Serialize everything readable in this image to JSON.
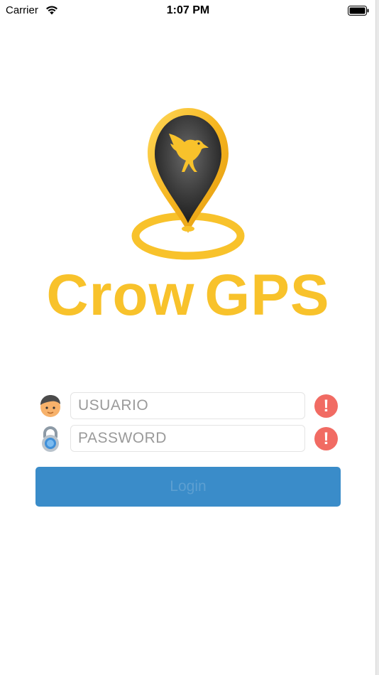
{
  "status_bar": {
    "carrier": "Carrier",
    "time": "1:07 PM",
    "icons": [
      "wifi-icon",
      "battery-icon"
    ]
  },
  "logo": {
    "brand_part1": "Crow",
    "brand_part2": "GPS",
    "brand_color": "#f8c22b",
    "mark_icon": "crow-location-pin-icon"
  },
  "form": {
    "username": {
      "placeholder": "USUARIO",
      "value": "",
      "icon": "user-avatar-icon",
      "alert_symbol": "!"
    },
    "password": {
      "placeholder": "PASSWORD",
      "value": "",
      "icon": "padlock-icon",
      "alert_symbol": "!"
    },
    "login_label": "Login",
    "login_color": "#3a8cc9",
    "alert_color": "#f16b63"
  }
}
